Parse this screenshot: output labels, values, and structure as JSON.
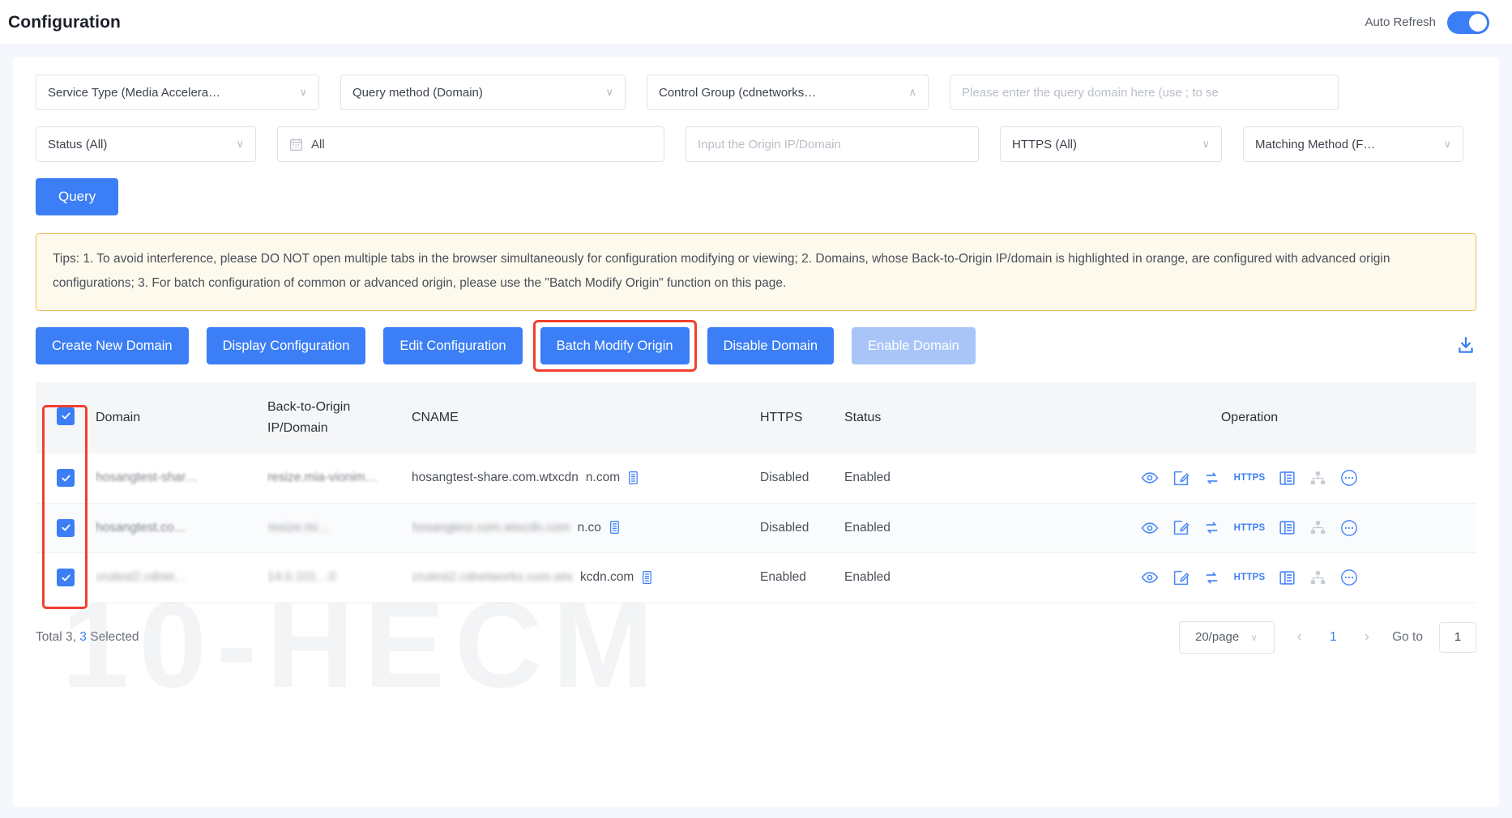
{
  "header": {
    "title": "Configuration",
    "auto_refresh_label": "Auto Refresh",
    "auto_refresh_on": true
  },
  "filters": {
    "service_type": "Service Type (Media Accelera…",
    "query_method": "Query method (Domain)",
    "control_group": "Control Group (cdnetworks…",
    "domain_placeholder": "Please enter the query domain here (use ; to se",
    "status": "Status (All)",
    "date_range": "All",
    "origin_placeholder": "Input the Origin IP/Domain",
    "https": "HTTPS (All)",
    "matching_method": "Matching Method (F…",
    "query_button": "Query"
  },
  "tips": "Tips: 1. To avoid interference, please DO NOT open multiple tabs in the browser simultaneously for configuration modifying or viewing; 2. Domains, whose Back-to-Origin IP/domain is highlighted in orange, are configured with advanced origin configurations; 3. For batch configuration of common or advanced origin, please use the \"Batch Modify Origin\" function on this page.",
  "actions": {
    "create_new_domain": "Create New Domain",
    "display_configuration": "Display Configuration",
    "edit_configuration": "Edit Configuration",
    "batch_modify_origin": "Batch Modify Origin",
    "disable_domain": "Disable Domain",
    "enable_domain": "Enable Domain",
    "download_icon": "download-icon"
  },
  "table": {
    "columns": {
      "domain": "Domain",
      "origin_line1": "Back-to-Origin",
      "origin_line2": "IP/Domain",
      "cname": "CNAME",
      "https": "HTTPS",
      "status": "Status",
      "operation": "Operation"
    },
    "header_checked": true,
    "rows": [
      {
        "checked": true,
        "domain": "hosangtest-shar…",
        "origin": "resize.mia-vionim…",
        "cname_main": "hosangtest-share.com.wtxcdn",
        "cname_tail": "n.com",
        "https": "Disabled",
        "status": "Enabled"
      },
      {
        "checked": true,
        "domain": "hosangtest.co…",
        "origin": "resize.mi…",
        "cname_main": "hosangtest.com.wtxcdn.com",
        "cname_tail": "n.co",
        "https": "Disabled",
        "status": "Enabled"
      },
      {
        "checked": true,
        "domain": "crutest2.cdnet…",
        "origin": "14.0.101…0",
        "cname_main": "crutest2.cdnetworks.com.wtx",
        "cname_tail": "kcdn.com",
        "https": "Enabled",
        "status": "Enabled"
      }
    ],
    "operation_icons": [
      "eye-icon",
      "edit-icon",
      "refresh-icon",
      "https-icon",
      "list-icon",
      "hierarchy-icon",
      "more-icon"
    ],
    "copy_icon": "copy-icon"
  },
  "footer": {
    "total_prefix": "Total 3,",
    "selected_count": "3",
    "selected_suffix": "Selected",
    "page_size": "20/page",
    "prev_arrow": "‹",
    "current_page": "1",
    "next_arrow": "›",
    "goto_label": "Go to",
    "goto_value": "1"
  },
  "watermark": "10-HECM",
  "colors": {
    "primary": "#3b7ef5",
    "primary_light": "#a9c5f8",
    "highlight": "#f0402f",
    "tips_border": "#f0b956",
    "tips_bg": "#fdf9ed"
  }
}
